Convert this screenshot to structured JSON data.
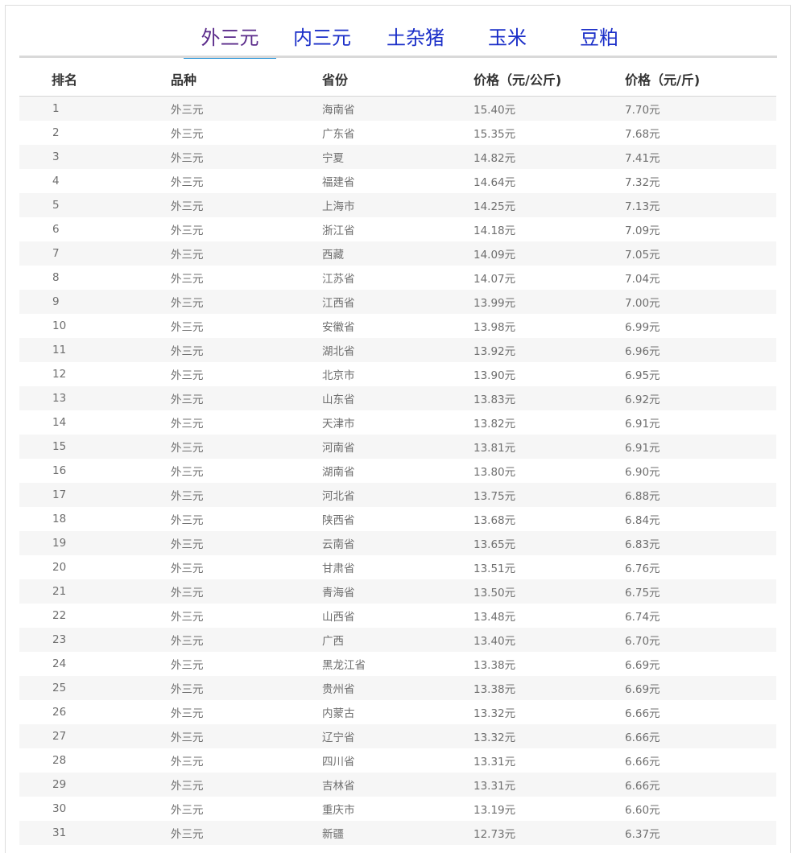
{
  "tabs": [
    {
      "label": "外三元",
      "active": true
    },
    {
      "label": "内三元",
      "active": false
    },
    {
      "label": "土杂猪",
      "active": false
    },
    {
      "label": "玉米",
      "active": false
    },
    {
      "label": "豆粕",
      "active": false
    }
  ],
  "colors": {
    "tab_text": "#1a2ec8",
    "tab_active_text": "#5a2a8a",
    "tab_underline": "#1e8fd6",
    "stripe": "#f6f6f6"
  },
  "table": {
    "headers": [
      "排名",
      "品种",
      "省份",
      "价格（元/公斤)",
      "价格（元/斤)"
    ],
    "rows": [
      [
        "1",
        "外三元",
        "海南省",
        "15.40元",
        "7.70元"
      ],
      [
        "2",
        "外三元",
        "广东省",
        "15.35元",
        "7.68元"
      ],
      [
        "3",
        "外三元",
        "宁夏",
        "14.82元",
        "7.41元"
      ],
      [
        "4",
        "外三元",
        "福建省",
        "14.64元",
        "7.32元"
      ],
      [
        "5",
        "外三元",
        "上海市",
        "14.25元",
        "7.13元"
      ],
      [
        "6",
        "外三元",
        "浙江省",
        "14.18元",
        "7.09元"
      ],
      [
        "7",
        "外三元",
        "西藏",
        "14.09元",
        "7.05元"
      ],
      [
        "8",
        "外三元",
        "江苏省",
        "14.07元",
        "7.04元"
      ],
      [
        "9",
        "外三元",
        "江西省",
        "13.99元",
        "7.00元"
      ],
      [
        "10",
        "外三元",
        "安徽省",
        "13.98元",
        "6.99元"
      ],
      [
        "11",
        "外三元",
        "湖北省",
        "13.92元",
        "6.96元"
      ],
      [
        "12",
        "外三元",
        "北京市",
        "13.90元",
        "6.95元"
      ],
      [
        "13",
        "外三元",
        "山东省",
        "13.83元",
        "6.92元"
      ],
      [
        "14",
        "外三元",
        "天津市",
        "13.82元",
        "6.91元"
      ],
      [
        "15",
        "外三元",
        "河南省",
        "13.81元",
        "6.91元"
      ],
      [
        "16",
        "外三元",
        "湖南省",
        "13.80元",
        "6.90元"
      ],
      [
        "17",
        "外三元",
        "河北省",
        "13.75元",
        "6.88元"
      ],
      [
        "18",
        "外三元",
        "陕西省",
        "13.68元",
        "6.84元"
      ],
      [
        "19",
        "外三元",
        "云南省",
        "13.65元",
        "6.83元"
      ],
      [
        "20",
        "外三元",
        "甘肃省",
        "13.51元",
        "6.76元"
      ],
      [
        "21",
        "外三元",
        "青海省",
        "13.50元",
        "6.75元"
      ],
      [
        "22",
        "外三元",
        "山西省",
        "13.48元",
        "6.74元"
      ],
      [
        "23",
        "外三元",
        "广西",
        "13.40元",
        "6.70元"
      ],
      [
        "24",
        "外三元",
        "黑龙江省",
        "13.38元",
        "6.69元"
      ],
      [
        "25",
        "外三元",
        "贵州省",
        "13.38元",
        "6.69元"
      ],
      [
        "26",
        "外三元",
        "内蒙古",
        "13.32元",
        "6.66元"
      ],
      [
        "27",
        "外三元",
        "辽宁省",
        "13.32元",
        "6.66元"
      ],
      [
        "28",
        "外三元",
        "四川省",
        "13.31元",
        "6.66元"
      ],
      [
        "29",
        "外三元",
        "吉林省",
        "13.31元",
        "6.66元"
      ],
      [
        "30",
        "外三元",
        "重庆市",
        "13.19元",
        "6.60元"
      ],
      [
        "31",
        "外三元",
        "新疆",
        "12.73元",
        "6.37元"
      ]
    ]
  }
}
